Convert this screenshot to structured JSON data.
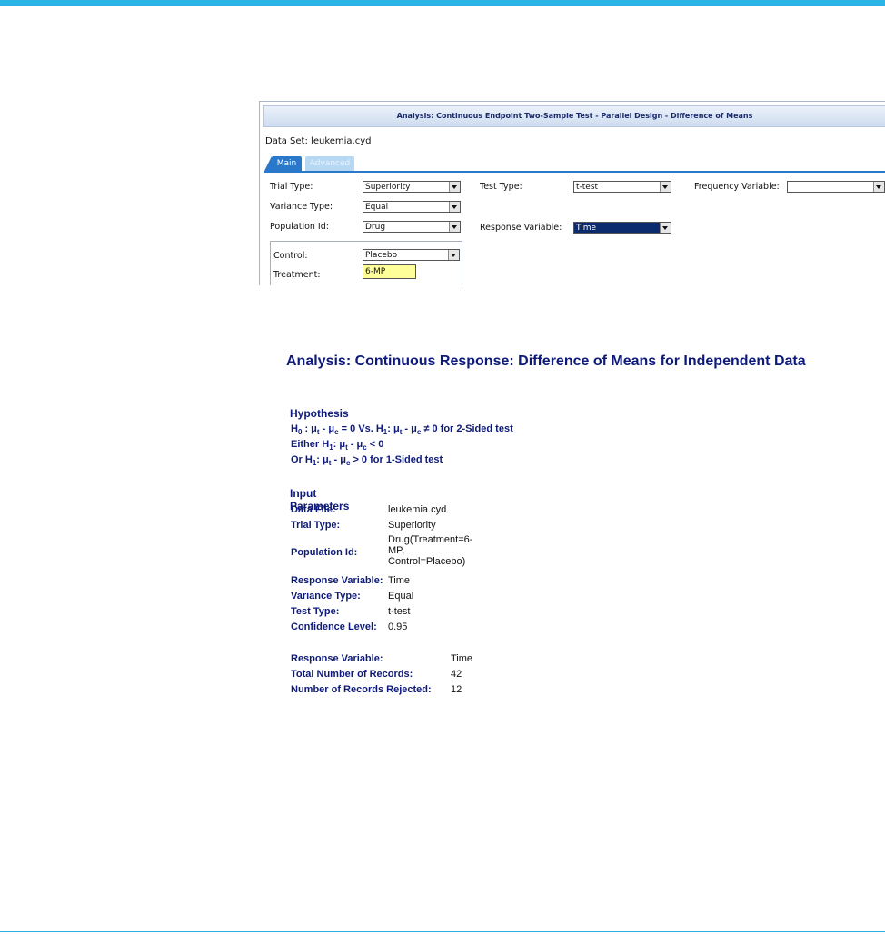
{
  "dialog": {
    "title": "Analysis: Continuous Endpoint Two-Sample Test - Parallel Design - Difference of Means",
    "dataset_label": "Data Set:",
    "dataset_value": "leukemia.cyd",
    "tabs": [
      "Main",
      "Advanced"
    ],
    "fields": {
      "trial_type": {
        "label": "Trial Type:",
        "value": "Superiority"
      },
      "variance_type": {
        "label": "Variance Type:",
        "value": "Equal"
      },
      "population_id": {
        "label": "Population Id:",
        "value": "Drug"
      },
      "test_type": {
        "label": "Test Type:",
        "value": "t-test"
      },
      "response_variable": {
        "label": "Response Variable:",
        "value": "Time"
      },
      "frequency_variable": {
        "label": "Frequency Variable:",
        "value": ""
      },
      "control": {
        "label": "Control:",
        "value": "Placebo"
      },
      "treatment": {
        "label": "Treatment:",
        "value": "6-MP"
      }
    },
    "colors": {
      "tab_active": "#2a78c9",
      "highlight": "#0c2a6e",
      "treatment_bg": "#ffff99"
    }
  },
  "report": {
    "title": "Analysis: Continuous Response: Difference of Means for Independent Data",
    "hypothesis": {
      "heading": "Hypothesis",
      "line1": {
        "a": "H",
        "s1": "0",
        "b": " : μ",
        "s2": "t",
        "c": " - μ",
        "s3": "c",
        "d": " = 0 Vs. H",
        "s4": "1",
        "e": ": μ",
        "s5": "t",
        "f": " - μ",
        "s6": "c",
        "g": " ≠ 0 for 2-Sided test"
      },
      "line2": {
        "a": "Either H",
        "s1": "1",
        "b": ": μ",
        "s2": "t",
        "c": " - μ",
        "s3": "c",
        "d": " < 0"
      },
      "line3": {
        "a": "Or H",
        "s1": "1",
        "b": ": μ",
        "s2": "t",
        "c": " - μ",
        "s3": "c",
        "d": " > 0 for 1-Sided test"
      }
    },
    "input_parameters": {
      "heading": "Input Parameters",
      "rows": [
        {
          "key": "Data File:",
          "value": "leukemia.cyd"
        },
        {
          "key": "Trial Type:",
          "value": "Superiority"
        },
        {
          "key": "Population Id:",
          "value_lines": [
            "Drug(Treatment=6-",
            "MP,",
            "Control=Placebo)"
          ]
        },
        {
          "key": "Response Variable:",
          "value": "Time"
        },
        {
          "key": "Variance Type:",
          "value": "Equal"
        },
        {
          "key": "Test Type:",
          "value": "t-test"
        },
        {
          "key": "Confidence Level:",
          "value": "0.95"
        }
      ]
    },
    "summary": [
      {
        "key": "Response Variable:",
        "value": "Time"
      },
      {
        "key": "Total Number of Records:",
        "value": "42"
      },
      {
        "key": "Number of Records Rejected:",
        "value": "12"
      }
    ]
  }
}
